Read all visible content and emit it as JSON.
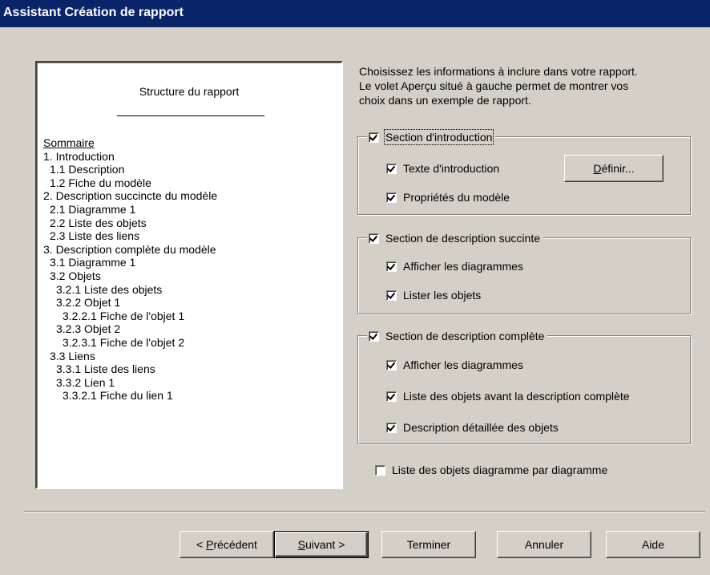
{
  "window": {
    "title": "Assistant Création de rapport"
  },
  "preview": {
    "title": "Structure du rapport",
    "toc": [
      {
        "text": "Sommaire",
        "indent": 0,
        "underline": true
      },
      {
        "text": "1. Introduction",
        "indent": 0
      },
      {
        "text": "1.1 Description",
        "indent": 1
      },
      {
        "text": "1.2 Fiche du modèle",
        "indent": 1
      },
      {
        "text": "2. Description succincte du modèle",
        "indent": 0
      },
      {
        "text": "2.1 Diagramme 1",
        "indent": 1
      },
      {
        "text": "2.2 Liste des objets",
        "indent": 1
      },
      {
        "text": "2.3 Liste des liens",
        "indent": 1
      },
      {
        "text": "3. Description complète du modèle",
        "indent": 0
      },
      {
        "text": "3.1 Diagramme 1",
        "indent": 1
      },
      {
        "text": "3.2 Objets",
        "indent": 1
      },
      {
        "text": "3.2.1 Liste des objets",
        "indent": 2
      },
      {
        "text": "3.2.2 Objet 1",
        "indent": 2
      },
      {
        "text": "3.2.2.1 Fiche de l'objet 1",
        "indent": 3
      },
      {
        "text": "3.2.3 Objet 2",
        "indent": 2
      },
      {
        "text": "3.2.3.1 Fiche de l'objet 2",
        "indent": 3
      },
      {
        "text": "3.3 Liens",
        "indent": 1
      },
      {
        "text": "3.3.1 Liste des liens",
        "indent": 2
      },
      {
        "text": "3.3.2 Lien 1",
        "indent": 2
      },
      {
        "text": "3.3.2.1 Fiche du lien 1",
        "indent": 3
      }
    ]
  },
  "description": [
    "Choisissez les informations à inclure dans votre rapport.",
    "Le volet Aperçu situé à gauche permet de montrer vos",
    "choix dans un exemple de rapport."
  ],
  "intro_section": {
    "label": "Section d'introduction",
    "checked": true,
    "options": [
      {
        "label": "Texte d'introduction",
        "checked": true
      },
      {
        "label": "Propriétés du modèle",
        "checked": true
      }
    ],
    "define_button": "Définir..."
  },
  "summary_section": {
    "label": "Section de description succinte",
    "checked": true,
    "options": [
      {
        "label": "Afficher les diagrammes",
        "checked": true
      },
      {
        "label": "Lister les objets",
        "checked": true
      }
    ]
  },
  "full_section": {
    "label": "Section de description complète",
    "checked": true,
    "options": [
      {
        "label": "Afficher les diagrammes",
        "checked": true
      },
      {
        "label": "Liste des objets avant la description complète",
        "checked": true
      },
      {
        "label": "Description détaillée des objets",
        "checked": true
      }
    ]
  },
  "per_diagram": {
    "label": "Liste des objets diagramme par diagramme",
    "checked": false
  },
  "buttons": {
    "previous": "< Précédent",
    "next": "Suivant >",
    "finish": "Terminer",
    "cancel": "Annuler",
    "help": "Aide"
  }
}
